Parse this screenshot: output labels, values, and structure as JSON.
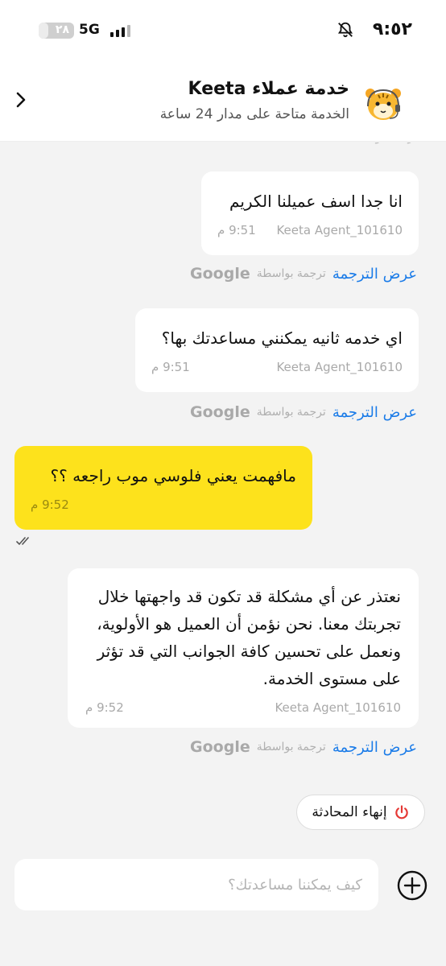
{
  "status_bar": {
    "battery": "٢٨",
    "battery_level": 0.28,
    "network": "5G",
    "time": "٩:٥٢"
  },
  "header": {
    "title": "خدمة عملاء Keeta",
    "subtitle": "الخدمة متاحة على مدار 24 ساعة"
  },
  "translation": {
    "show_label": "عرض الترجمة",
    "by_label": "ترجمة بواسطة",
    "provider": "Google"
  },
  "messages": [
    {
      "sender": "Keeta Agent_101610",
      "text": "انا جدا اسف عميلنا الكريم",
      "time": "9:51 م"
    },
    {
      "sender": "Keeta Agent_101610",
      "text": "اي خدمه ثانيه يمكنني مساعدتك بها؟",
      "time": "9:51 م"
    },
    {
      "sender": "",
      "text": "مافهمت يعني فلوسي موب راجعه ؟؟",
      "time": "9:52 م"
    },
    {
      "sender": "Keeta Agent_101610",
      "text": "نعتذر عن أي مشكلة قد تكون قد واجهتها خلال تجربتك معنا. نحن نؤمن أن العميل هو الأولوية، ونعمل على تحسين كافة الجوانب التي قد تؤثر على مستوى الخدمة.",
      "time": "9:52 م"
    }
  ],
  "actions": {
    "end_chat": "إنهاء المحادثة"
  },
  "composer": {
    "placeholder": "كيف يمكننا مساعدتك؟"
  },
  "colors": {
    "accent_yellow": "#fde21c",
    "link_blue": "#1a7be8",
    "end_red": "#e53935"
  },
  "icons": [
    "back-chevron-icon",
    "tiger-avatar-icon",
    "muted-bell-icon",
    "power-icon",
    "plus-icon",
    "double-check-icon"
  ]
}
